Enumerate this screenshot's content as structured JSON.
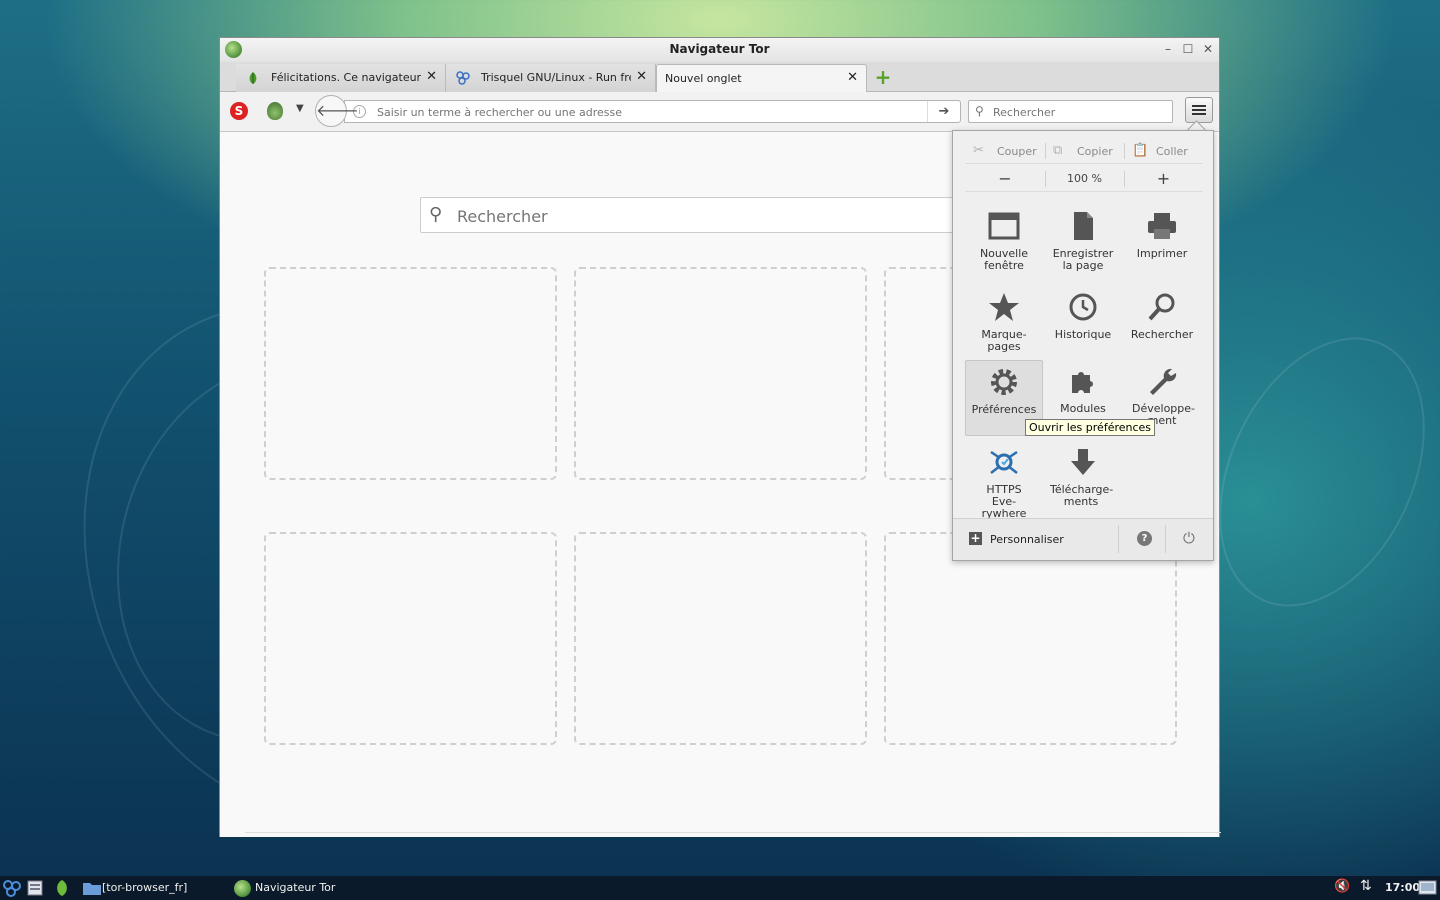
{
  "window": {
    "title": "Navigateur Tor"
  },
  "tabs": [
    {
      "label": "Félicitations. Ce navigateur e...",
      "active": false,
      "favicon": "leaf-icon"
    },
    {
      "label": "Trisquel GNU/Linux - Run free!",
      "active": false,
      "favicon": "trisquel-icon"
    },
    {
      "label": "Nouvel onglet",
      "active": true,
      "favicon": ""
    }
  ],
  "toolbar": {
    "url_placeholder": "Saisir un terme à rechercher ou une adresse",
    "search_placeholder": "Rechercher"
  },
  "content": {
    "search_placeholder": "Rechercher",
    "tile_count": 6
  },
  "menu": {
    "edit": {
      "cut": "Couper",
      "copy": "Copier",
      "paste": "Coller"
    },
    "zoom": {
      "minus": "−",
      "level": "100 %",
      "plus": "+"
    },
    "items": [
      {
        "label": "Nouvelle fenêtre",
        "icon": "window-icon"
      },
      {
        "label": "Enregistrer la page",
        "icon": "page-icon"
      },
      {
        "label": "Imprimer",
        "icon": "printer-icon"
      },
      {
        "label": "Marque-pages",
        "icon": "star-icon"
      },
      {
        "label": "Historique",
        "icon": "clock-icon"
      },
      {
        "label": "Rechercher",
        "icon": "magnifier-icon"
      },
      {
        "label": "Préférences",
        "icon": "gear-icon"
      },
      {
        "label": "Modules",
        "icon": "puzzle-icon"
      },
      {
        "label": "Développe-ment",
        "icon": "wrench-icon"
      },
      {
        "label": "HTTPS Eve-rywhere",
        "icon": "https-everywhere-icon"
      },
      {
        "label": "Télécharge-ments",
        "icon": "download-icon"
      }
    ],
    "tooltip": "Ouvrir les préférences",
    "customize": "Personnaliser"
  },
  "taskbar": {
    "folder_label": "[tor-browser_fr]",
    "window_label": "Navigateur Tor",
    "clock": "17:00"
  }
}
